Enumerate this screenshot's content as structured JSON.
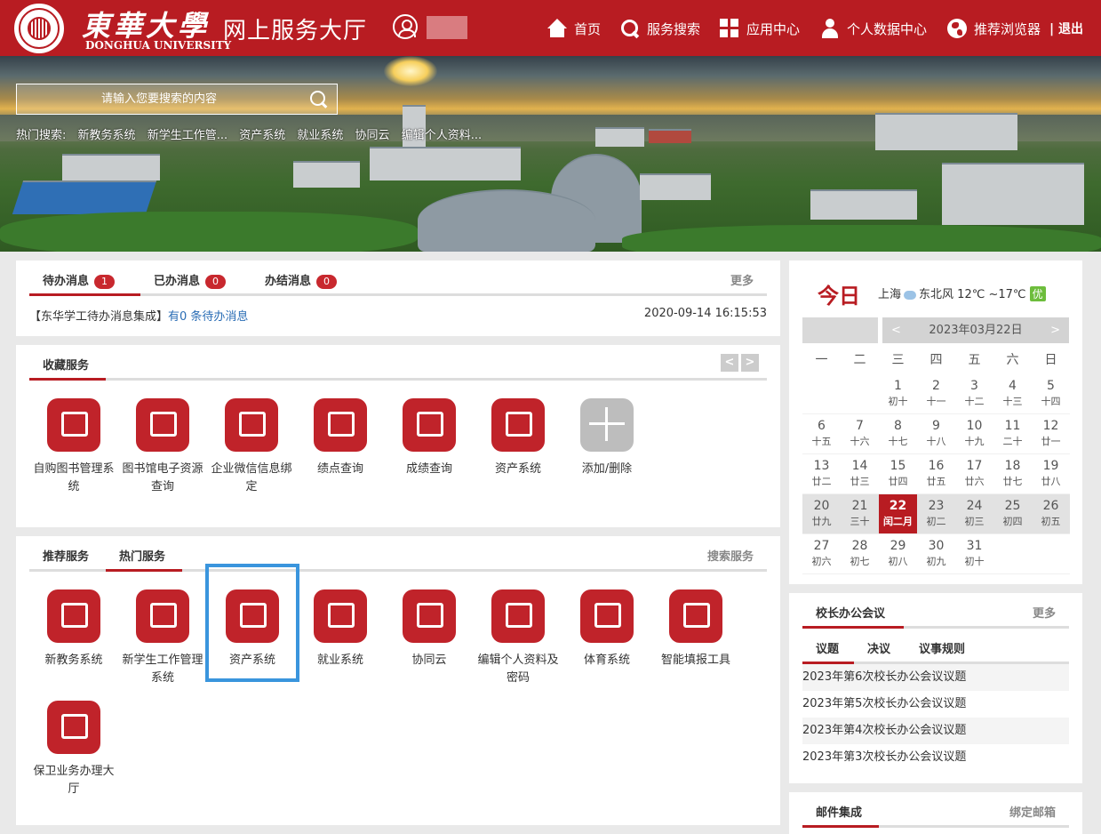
{
  "header": {
    "logo_cn": "東華大學",
    "logo_en": "DONGHUA UNIVERSITY",
    "hall_title": "网上服务大厅",
    "nav": [
      {
        "label": "首页",
        "icon": "home-icon"
      },
      {
        "label": "服务搜索",
        "icon": "search-icon"
      },
      {
        "label": "应用中心",
        "icon": "grid-icon"
      },
      {
        "label": "个人数据中心",
        "icon": "person-icon"
      },
      {
        "label": "推荐浏览器",
        "icon": "globe-icon"
      }
    ],
    "logout": "| 退出"
  },
  "banner": {
    "search_placeholder": "请输入您要搜索的内容",
    "hot_label": "热门搜索:",
    "hot_items": [
      "新教务系统",
      "新学生工作管...",
      "资产系统",
      "就业系统",
      "协同云",
      "编辑个人资料..."
    ]
  },
  "messages": {
    "tabs": [
      {
        "label": "待办消息",
        "count": "1"
      },
      {
        "label": "已办消息",
        "count": "0"
      },
      {
        "label": "办结消息",
        "count": "0"
      }
    ],
    "more": "更多",
    "item_prefix": "【东华学工待办消息集成】",
    "item_link": "有0 条待办消息",
    "item_time": "2020-09-14 16:15:53"
  },
  "favorites": {
    "title": "收藏服务",
    "prev": "<",
    "next": ">",
    "items": [
      {
        "label": "自购图书管理系统",
        "icon": "book-screen-icon"
      },
      {
        "label": "图书馆电子资源查询",
        "icon": "folder-search-icon"
      },
      {
        "label": "企业微信信息绑定",
        "icon": "document-link-icon"
      },
      {
        "label": "绩点查询",
        "icon": "score-search-icon"
      },
      {
        "label": "成绩查询",
        "icon": "grade-a-icon"
      },
      {
        "label": "资产系统",
        "icon": "asset-screen-icon"
      },
      {
        "label": "添加/删除",
        "icon": "add-remove-icon"
      }
    ]
  },
  "services": {
    "tabs": [
      "推荐服务",
      "热门服务"
    ],
    "search_label": "搜索服务",
    "items": [
      {
        "label": "新教务系统",
        "icon": "monitor-chart-icon"
      },
      {
        "label": "新学生工作管理系统",
        "icon": "monitor-gear-icon"
      },
      {
        "label": "资产系统",
        "icon": "asset-screen-icon"
      },
      {
        "label": "就业系统",
        "icon": "clipboard-briefcase-icon"
      },
      {
        "label": "协同云",
        "icon": "cloud-icon"
      },
      {
        "label": "编辑个人资料及密码",
        "icon": "document-person-icon"
      },
      {
        "label": "体育系统",
        "icon": "sports-screen-icon"
      },
      {
        "label": "智能填报工具",
        "icon": "document-pen-icon"
      },
      {
        "label": "保卫业务办理大厅",
        "icon": "security-screen-icon"
      }
    ]
  },
  "calendar": {
    "today_label": "今日",
    "weather": {
      "city": "上海",
      "wind": "东北风",
      "temp": "12℃ ~17℃",
      "aqi": "优"
    },
    "month_label": "2023年03月22日",
    "prev": "<",
    "next": ">",
    "weekdays": [
      "一",
      "二",
      "三",
      "四",
      "五",
      "六",
      "日"
    ],
    "weeks": [
      [
        [
          "",
          ""
        ],
        [
          "",
          ""
        ],
        [
          "1",
          "初十"
        ],
        [
          "2",
          "十一"
        ],
        [
          "3",
          "十二"
        ],
        [
          "4",
          "十三"
        ],
        [
          "5",
          "十四"
        ]
      ],
      [
        [
          "6",
          "十五"
        ],
        [
          "7",
          "十六"
        ],
        [
          "8",
          "十七"
        ],
        [
          "9",
          "十八"
        ],
        [
          "10",
          "十九"
        ],
        [
          "11",
          "二十"
        ],
        [
          "12",
          "廿一"
        ]
      ],
      [
        [
          "13",
          "廿二"
        ],
        [
          "14",
          "廿三"
        ],
        [
          "15",
          "廿四"
        ],
        [
          "16",
          "廿五"
        ],
        [
          "17",
          "廿六"
        ],
        [
          "18",
          "廿七"
        ],
        [
          "19",
          "廿八"
        ]
      ],
      [
        [
          "20",
          "廿九"
        ],
        [
          "21",
          "三十"
        ],
        [
          "22",
          "闰二月"
        ],
        [
          "23",
          "初二"
        ],
        [
          "24",
          "初三"
        ],
        [
          "25",
          "初四"
        ],
        [
          "26",
          "初五"
        ]
      ],
      [
        [
          "27",
          "初六"
        ],
        [
          "28",
          "初七"
        ],
        [
          "29",
          "初八"
        ],
        [
          "30",
          "初九"
        ],
        [
          "31",
          "初十"
        ],
        [
          "",
          ""
        ],
        [
          "",
          ""
        ]
      ]
    ],
    "today_day": "22"
  },
  "meetings": {
    "title": "校长办公会议",
    "more": "更多",
    "tabs": [
      "议题",
      "决议",
      "议事规则"
    ],
    "items": [
      "2023年第6次校长办公会议议题",
      "2023年第5次校长办公会议议题",
      "2023年第4次校长办公会议议题",
      "2023年第3次校长办公会议议题"
    ]
  },
  "mail": {
    "title": "邮件集成",
    "bind": "绑定邮箱"
  },
  "colors": {
    "brand": "#b81c22",
    "selection": "#3a95dd",
    "aqi": "#6dbd3c"
  }
}
